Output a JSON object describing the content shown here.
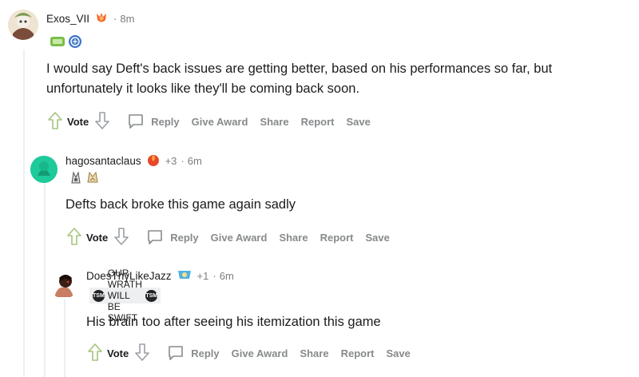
{
  "comments": [
    {
      "username": "Exos_VII",
      "time": "8m",
      "text_lines": [
        "I would say Deft's back issues are getting better, based on his performances so far, but",
        "unfortunately it looks like they'll be coming back soon."
      ]
    },
    {
      "username": "hagosantaclaus",
      "score": "+3",
      "time": "6m",
      "text": "Defts back broke this game again sadly"
    },
    {
      "username": "DoesThyLikeJazz",
      "score": "+1",
      "time": "6m",
      "flair_text": "OUR WRATH WILL BE SWIFT",
      "flair_badge": "TSM",
      "text": "His brain too after seeing his itemization this game"
    }
  ],
  "actions": {
    "vote": "Vote",
    "reply": "Reply",
    "give_award": "Give Award",
    "share": "Share",
    "report": "Report",
    "save": "Save"
  },
  "separator": "·",
  "colors": {
    "text": "#1c1c1c",
    "meta": "#7c7c7c",
    "action": "#878a8c",
    "thread_line": "#edeff1",
    "avatar2": "#1ec99a"
  }
}
